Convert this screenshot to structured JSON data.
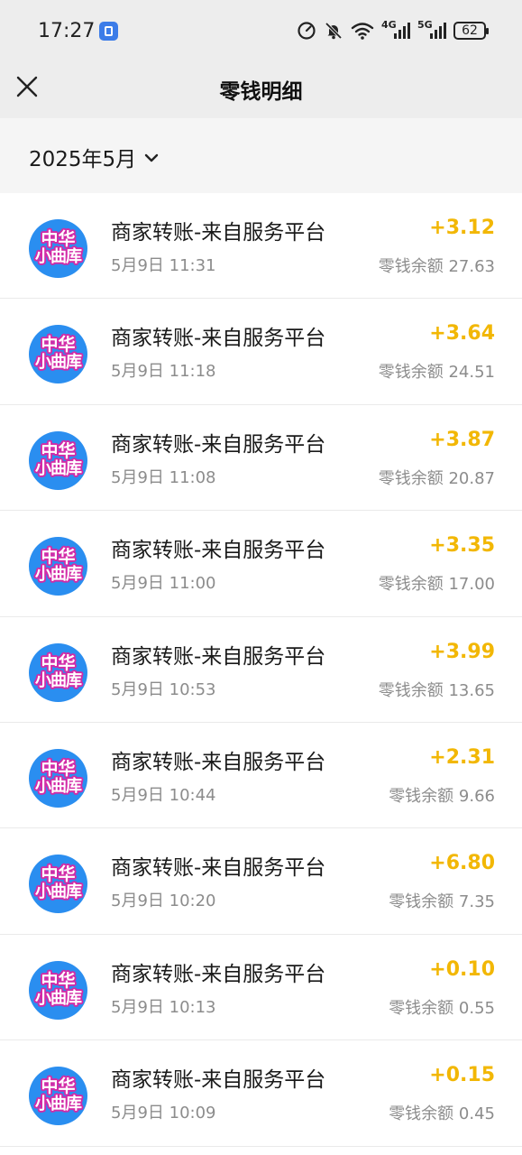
{
  "status_bar": {
    "time": "17:27",
    "network_4g": "4G",
    "network_5g": "5G",
    "battery": "62"
  },
  "header": {
    "title": "零钱明细",
    "close_icon": "close-icon"
  },
  "filter": {
    "month": "2025年5月",
    "chevron_icon": "chevron-down-icon"
  },
  "avatar": {
    "line1": "中华",
    "line2": "小曲库",
    "background": "#2a8ef0",
    "outline": "#d22ba7"
  },
  "colors": {
    "amount_positive": "#f2b705",
    "secondary_text": "#8c8c8c",
    "header_bg": "#ededed"
  },
  "transactions": [
    {
      "title": "商家转账-来自服务平台",
      "time": "5月9日 11:31",
      "amount": "+3.12",
      "balance": "零钱余额 27.63"
    },
    {
      "title": "商家转账-来自服务平台",
      "time": "5月9日 11:18",
      "amount": "+3.64",
      "balance": "零钱余额 24.51"
    },
    {
      "title": "商家转账-来自服务平台",
      "time": "5月9日 11:08",
      "amount": "+3.87",
      "balance": "零钱余额 20.87"
    },
    {
      "title": "商家转账-来自服务平台",
      "time": "5月9日 11:00",
      "amount": "+3.35",
      "balance": "零钱余额 17.00"
    },
    {
      "title": "商家转账-来自服务平台",
      "time": "5月9日 10:53",
      "amount": "+3.99",
      "balance": "零钱余额 13.65"
    },
    {
      "title": "商家转账-来自服务平台",
      "time": "5月9日 10:44",
      "amount": "+2.31",
      "balance": "零钱余额 9.66"
    },
    {
      "title": "商家转账-来自服务平台",
      "time": "5月9日 10:20",
      "amount": "+6.80",
      "balance": "零钱余额 7.35"
    },
    {
      "title": "商家转账-来自服务平台",
      "time": "5月9日 10:13",
      "amount": "+0.10",
      "balance": "零钱余额 0.55"
    },
    {
      "title": "商家转账-来自服务平台",
      "time": "5月9日 10:09",
      "amount": "+0.15",
      "balance": "零钱余额 0.45"
    }
  ]
}
